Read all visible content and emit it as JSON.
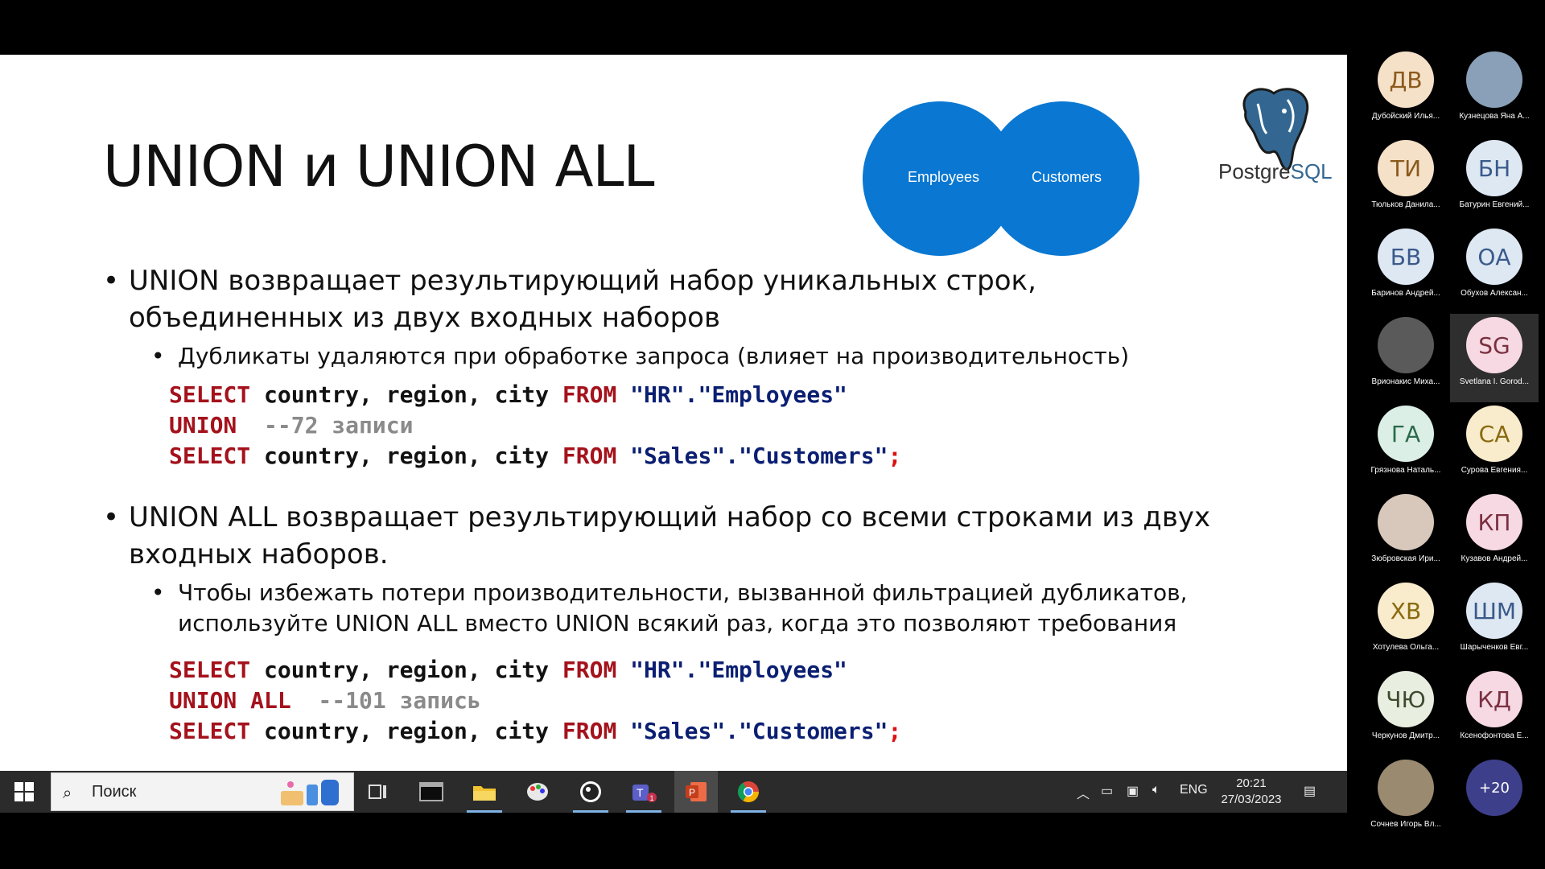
{
  "slide": {
    "title": "UNION и UNION ALL",
    "venn": {
      "left": "Employees",
      "right": "Customers"
    },
    "logo_text_a": "Postgre",
    "logo_text_b": "SQL",
    "bullet1": "UNION возвращает результирующий набор уникальных строк, объединенных из двух входных наборов",
    "bullet1_sub": "Дубликаты удаляются при обработке запроса (влияет на производительность)",
    "code1": {
      "l1_kw1": "SELECT",
      "l1_cols": " country, region, city ",
      "l1_kw2": "FROM",
      "l1_tbl": " \"HR\".\"Employees\"",
      "l2_kw": "UNION",
      "l2_cmt": "  --72 записи",
      "l3_kw1": "SELECT",
      "l3_cols": " country, region, city ",
      "l3_kw2": "FROM",
      "l3_tbl": " \"Sales\".\"Customers\"",
      "l3_semi": ";"
    },
    "bullet2": "UNION ALL возвращает результирующий набор со всеми строками из двух входных наборов.",
    "bullet2_sub": "Чтобы избежать потери производительности, вызванной фильтрацией дубликатов, используйте UNION ALL вместо UNION всякий раз, когда это позволяют требования",
    "code2": {
      "l1_kw1": "SELECT",
      "l1_cols": " country, region, city ",
      "l1_kw2": "FROM",
      "l1_tbl": " \"HR\".\"Employees\"",
      "l2_kw": "UNION ALL",
      "l2_cmt": "  --101 запись",
      "l3_kw1": "SELECT",
      "l3_cols": " country, region, city ",
      "l3_kw2": "FROM",
      "l3_tbl": " \"Sales\".\"Customers\"",
      "l3_semi": ";"
    }
  },
  "taskbar": {
    "search_placeholder": "Поиск",
    "language": "ENG",
    "time": "20:21",
    "date": "27/03/2023",
    "apps": [
      "task-view-icon",
      "terminal-icon",
      "file-explorer-icon",
      "paint-icon",
      "app-icon",
      "teams-icon",
      "powerpoint-icon",
      "chrome-icon"
    ],
    "teams_badge": "1"
  },
  "participants": [
    {
      "initials": "ДВ",
      "name": "Дубойский Илья...",
      "bg": "#f5e0c8",
      "fg": "#8a5a1c"
    },
    {
      "initials": "",
      "name": "Кузнецова Яна А...",
      "bg": "#8aa0b8",
      "fg": "#fff"
    },
    {
      "initials": "ТИ",
      "name": "Тюльков Данила...",
      "bg": "#f5e0c8",
      "fg": "#8a5a1c"
    },
    {
      "initials": "БН",
      "name": "Батурин Евгений...",
      "bg": "#dde8f3",
      "fg": "#3a5a8a"
    },
    {
      "initials": "БВ",
      "name": "Баринов Андрей...",
      "bg": "#dde8f3",
      "fg": "#3a5a8a"
    },
    {
      "initials": "ОА",
      "name": "Обухов Алексан...",
      "bg": "#dde8f3",
      "fg": "#3a5a8a"
    },
    {
      "initials": "",
      "name": "Врионакис Миха...",
      "bg": "#5a5a5a",
      "fg": "#fff"
    },
    {
      "initials": "SG",
      "name": "Svetlana I. Gorod...",
      "bg": "#f6d9e2",
      "fg": "#7a3040"
    },
    {
      "initials": "ГА",
      "name": "Грязнова Наталь...",
      "bg": "#dcefe6",
      "fg": "#2a6a4a"
    },
    {
      "initials": "СА",
      "name": "Сурова Евгения...",
      "bg": "#f8eccc",
      "fg": "#8a6a10"
    },
    {
      "initials": "",
      "name": "Зюбровская Ири...",
      "bg": "#d8c8bc",
      "fg": "#fff"
    },
    {
      "initials": "КП",
      "name": "Кузавов Андрей...",
      "bg": "#f6d9e2",
      "fg": "#7a3040"
    },
    {
      "initials": "ХВ",
      "name": "Хотулева Ольга...",
      "bg": "#f8eccc",
      "fg": "#8a6a10"
    },
    {
      "initials": "ШМ",
      "name": "Шарыченков Евг...",
      "bg": "#dde8f3",
      "fg": "#3a5a8a"
    },
    {
      "initials": "ЧЮ",
      "name": "Черкунов Дмитр...",
      "bg": "#e8eee0",
      "fg": "#3e4a2e"
    },
    {
      "initials": "КД",
      "name": "Ксенофонтова Е...",
      "bg": "#f6d9e2",
      "fg": "#7a3040"
    },
    {
      "initials": "",
      "name": "Сочнев Игорь Вл...",
      "bg": "#9a8a70",
      "fg": "#fff"
    },
    {
      "initials": "+20",
      "name": "",
      "bg": "#3d3f8a",
      "fg": "#fff"
    }
  ]
}
